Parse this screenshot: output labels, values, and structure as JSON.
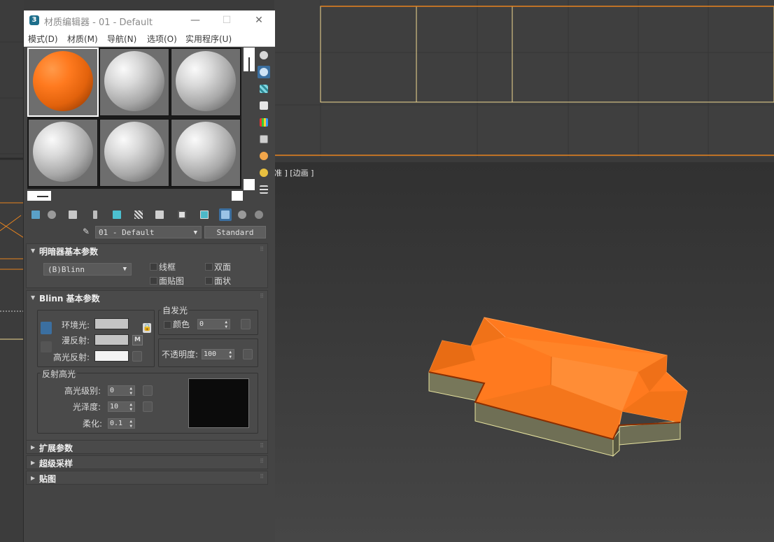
{
  "window": {
    "title": "材质编辑器 - 01 - Default",
    "app_icon": "3",
    "minimize": "—",
    "maximize": "☐",
    "close": "✕"
  },
  "menu": [
    "模式(D)",
    "材质(M)",
    "导航(N)",
    "选项(O)",
    "实用程序(U)"
  ],
  "viewport_label": "准 ] [边画 ]",
  "material": {
    "name": "01 - Default",
    "type": "Standard"
  },
  "shader_rollout": {
    "title": "明暗器基本参数",
    "shader": "(B)Blinn",
    "wire": "线框",
    "two_sided": "双面",
    "face_map": "面贴图",
    "faceted": "面状"
  },
  "blinn_rollout": {
    "title": "Blinn 基本参数",
    "self_illum_group": "自发光",
    "color_label": "颜色",
    "self_illum_value": "0",
    "ambient": "环境光:",
    "diffuse": "漫反射:",
    "specular": "高光反射:",
    "m_button": "M",
    "opacity": "不透明度:",
    "opacity_value": "100",
    "spec_group": "反射高光",
    "spec_level": "高光级别:",
    "spec_level_value": "0",
    "glossiness": "光泽度:",
    "glossiness_value": "10",
    "soften": "柔化:",
    "soften_value": "0.1"
  },
  "rollouts_collapsed": [
    "扩展参数",
    "超级采样",
    "贴图"
  ],
  "colors": {
    "accent_orange": "#ff7a1f",
    "grid_yellow": "#f0d890",
    "orange_line": "#e8841e"
  }
}
